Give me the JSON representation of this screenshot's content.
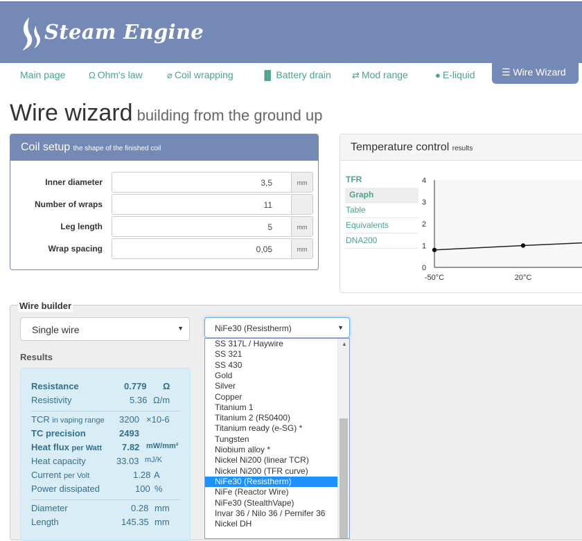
{
  "app": {
    "name": "Steam Engine"
  },
  "nav": {
    "items": [
      {
        "label": "Main page",
        "icon": ""
      },
      {
        "label": "Ohm's law",
        "icon": "omega-icon"
      },
      {
        "label": "Coil wrapping",
        "icon": "paperclip-icon"
      },
      {
        "label": "Battery drain",
        "icon": "bar-chart-icon"
      },
      {
        "label": "Mod range",
        "icon": "swap-arrows-icon"
      },
      {
        "label": "E-liquid",
        "icon": "droplet-icon"
      },
      {
        "label": "Wire Wizard",
        "icon": "list-icon",
        "active": true
      }
    ]
  },
  "page": {
    "title": "Wire wizard",
    "subtitle": "building from the ground up"
  },
  "coil_setup": {
    "title": "Coil setup",
    "subtitle": "the shape of the finished coil",
    "fields": [
      {
        "label": "Inner diameter",
        "value": "3,5",
        "unit": "mm"
      },
      {
        "label": "Number of wraps",
        "value": "11",
        "unit": ""
      },
      {
        "label": "Leg length",
        "value": "5",
        "unit": "mm"
      },
      {
        "label": "Wrap spacing",
        "value": "0,05",
        "unit": "mm"
      }
    ]
  },
  "temp_control": {
    "title": "Temperature control",
    "subtitle": "results",
    "menu_header": "TFR",
    "menu": [
      "Graph",
      "Table",
      "Equivalents",
      "DNA200"
    ],
    "active_menu": "Graph"
  },
  "chart_data": {
    "type": "line",
    "x_tick_labels": [
      "-50°C",
      "20°C"
    ],
    "y_tick_labels": [
      "0",
      "1",
      "2",
      "3",
      "4"
    ],
    "ylim": [
      0,
      4
    ],
    "grid": false,
    "series": [
      {
        "x": [
          -50,
          20,
          70
        ],
        "y": [
          0.8,
          1.0,
          1.13
        ]
      }
    ]
  },
  "wire_builder": {
    "legend": "Wire builder",
    "type_select": "Single wire",
    "material_select": "NiFe30 (Resistherm)",
    "results_label": "Results",
    "results": [
      {
        "label": "Resistance",
        "value": "0.779",
        "unit": "Ω",
        "bold": true
      },
      {
        "label": "Resistivity",
        "value": "5.36",
        "unit": "Ω/m"
      },
      {
        "label": "TCR",
        "label_small": "in vaping range",
        "value": "3200",
        "unit": "×10-6"
      },
      {
        "label": "TC precision",
        "value": "2493",
        "unit": "",
        "bold": true
      },
      {
        "label": "Heat flux",
        "label_small": "per Watt",
        "value": "7.82",
        "unit": "mW/mm²",
        "bold": true
      },
      {
        "label": "Heat capacity",
        "value": "33.03",
        "unit": "mJ/K"
      },
      {
        "label": "Current",
        "label_small": "per Volt",
        "value": "1.28",
        "unit": "A"
      },
      {
        "label": "Power dissipated",
        "value": "100",
        "unit": "%"
      },
      {
        "label": "Diameter",
        "value": "0.28",
        "unit": "mm"
      },
      {
        "label": "Length",
        "value": "145.35",
        "unit": "mm"
      }
    ],
    "material_options": [
      "SS 317L / Haywire",
      "SS 321",
      "SS 430",
      "Gold",
      "Silver",
      "Copper",
      "Titanium 1",
      "Titanium 2 (R50400)",
      "Titanium ready (e-SG) *",
      "Tungsten",
      "Niobium alloy *",
      "Nickel Ni200 (linear TCR)",
      "Nickel Ni200 (TFR curve)",
      "NiFe30 (Resistherm)",
      "NiFe (Reactor Wire)",
      "NiFe30 (StealthVape)",
      "Invar 36 / Nilo 36 / Pernifer 36",
      "Nickel DH"
    ],
    "selected_option": "NiFe30 (Resistherm)"
  }
}
